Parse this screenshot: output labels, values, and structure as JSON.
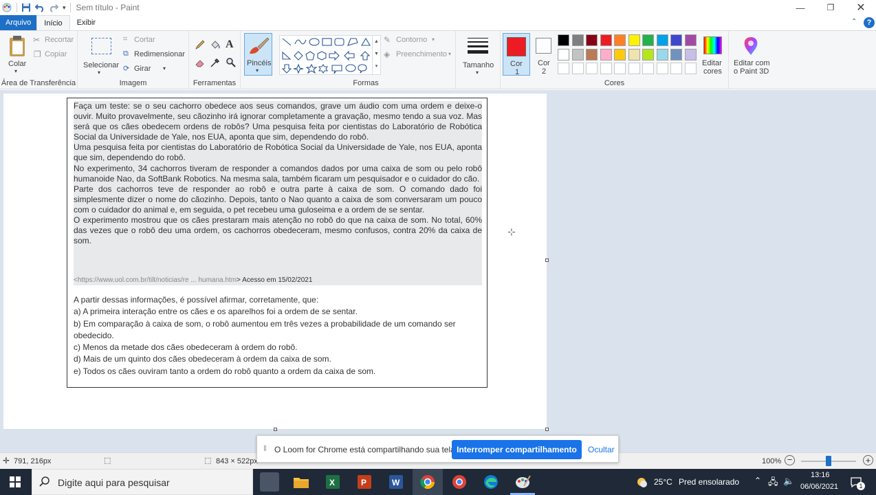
{
  "window": {
    "title": "Sem título - Paint"
  },
  "tabs": [
    {
      "label": "Arquivo"
    },
    {
      "label": "Início"
    },
    {
      "label": "Exibir"
    }
  ],
  "ribbon": {
    "clipboard": {
      "paste": "Colar",
      "cut": "Recortar",
      "copy": "Copiar",
      "label": "Área de Transferência"
    },
    "image": {
      "select": "Selecionar",
      "crop": "Cortar",
      "resize": "Redimensionar",
      "rotate": "Girar",
      "label": "Imagem"
    },
    "tools": {
      "label": "Ferramentas"
    },
    "brushes": {
      "label": "Pincéis"
    },
    "shapes": {
      "outline": "Contorno",
      "fill": "Preenchimento",
      "label": "Formas"
    },
    "size": {
      "label": "Tamanho"
    },
    "colors": {
      "color1": "Cor",
      "color1_num": "1",
      "color2": "Cor",
      "color2_num": "2",
      "edit": "Editar",
      "edit2": "cores",
      "paint3d": "Editar com",
      "paint3d2": "o Paint 3D",
      "label": "Cores",
      "active_color": "#ed1c24",
      "row1": [
        "#000000",
        "#7f7f7f",
        "#880015",
        "#ed1c24",
        "#ff7f27",
        "#fff200",
        "#22b14c",
        "#00a2e8",
        "#3f48cc",
        "#a349a4"
      ],
      "row2": [
        "#ffffff",
        "#c3c3c3",
        "#b97a57",
        "#ffaec9",
        "#ffc90e",
        "#efe4b0",
        "#b5e61d",
        "#99d9ea",
        "#7092be",
        "#c8bfe7"
      ]
    }
  },
  "document": {
    "passage": [
      "Faça um teste: se o seu cachorro obedece aos seus comandos, grave um áudio com uma ordem e deixe-o ouvir. Muito provavelmente, seu cãozinho irá ignorar completamente a gravação, mesmo tendo a sua voz. Mas será que os cães obedecem ordens de robôs? Uma pesquisa feita por cientistas do Laboratório de Robótica Social da Universidade de Yale, nos EUA, aponta que sim, dependendo do robô.",
      "Uma pesquisa feita por cientistas do Laboratório de Robótica Social da Universidade de Yale, nos EUA, aponta que sim, dependendo do robô.",
      "No experimento, 34 cachorros tiveram de responder a comandos dados por uma caixa de som ou pelo robô humanoide Nao, da SoftBank Robotics. Na mesma sala, também ficaram um pesquisador e o cuidador do cão.",
      "Parte dos cachorros teve de responder ao robô e outra parte à caixa de som. O comando dado foi simplesmente dizer o nome do cãozinho. Depois, tanto o Nao quanto a caixa de som conversaram um pouco com o cuidador do animal e, em seguida, o pet recebeu uma guloseima e a ordem de se sentar.",
      "O experimento mostrou que os cães prestaram mais atenção no robô do que na caixa de som. No total, 60% das vezes que o robô deu uma ordem, os cachorros obedeceram, mesmo confusos, contra 20% da caixa de som."
    ],
    "source_url": "<https://www.uol.com.br/tilt/noticias/re ... humana.htm",
    "source_access": "> Acesso em 15/02/2021",
    "question": "A partir dessas informações, é possível afirmar, corretamente, que:",
    "options": [
      "a) A primeira interação entre os cães e os aparelhos foi a ordem de se sentar.",
      "b) Em comparação à caixa de som, o robô aumentou em três vezes a probabilidade de um comando ser obedecido.",
      "c) Menos da metade dos cães obedeceram à ordem do robô.",
      "d) Mais de um quinto dos cães obedeceram à ordem da caixa de som.",
      "e) Todos os cães ouviram tanto a ordem do robô quanto a ordem da caixa de som."
    ]
  },
  "status": {
    "cursor_pos": "791, 216px",
    "canvas_size": "843 × 522px",
    "zoom": "100%",
    "zoom_level": 0.5
  },
  "loom": {
    "message": "O Loom for Chrome está compartilhando sua tela.",
    "stop": "Interromper compartilhamento",
    "hide": "Ocultar"
  },
  "taskbar": {
    "search_placeholder": "Digite aqui para pesquisar",
    "weather_temp": "25°C",
    "weather_desc": "Pred ensolarado",
    "time": "13:16",
    "date": "06/06/2021",
    "notifications": "1"
  }
}
